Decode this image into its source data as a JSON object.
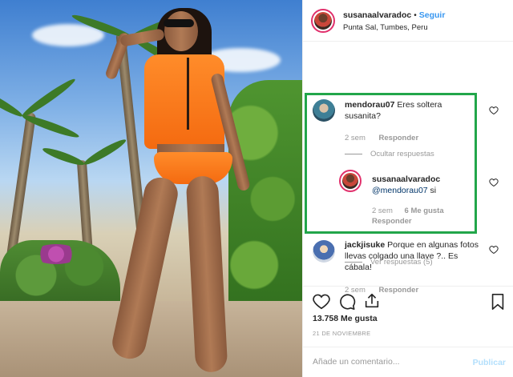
{
  "post": {
    "username": "susanaalvaradoc",
    "separator": "•",
    "follow_label": "Seguir",
    "location": "Punta Sal, Tumbes, Peru"
  },
  "comments": [
    {
      "username": "mendorau07",
      "text": "Eres soltera susanita?⁣",
      "time": "2 sem",
      "reply_label": "Responder",
      "toggle_replies": "Ocultar respuestas",
      "replies": [
        {
          "username": "susanaalvaradoc",
          "mention": "@mendorau07",
          "text": " si",
          "time": "2 sem",
          "likes": "6 Me gusta",
          "reply_label": "Responder"
        }
      ]
    },
    {
      "username": "jackjisuke",
      "text": "Porque en algunas fotos llevas colgado una llave ⁣?.. Es cábala! ⁣",
      "time": "2 sem",
      "reply_label": "Responder",
      "toggle_replies": "Ver respuestas (5)"
    }
  ],
  "actions": {
    "likes": "13.758 Me gusta",
    "date": "21 DE NOVIEMBRE"
  },
  "add_comment": {
    "placeholder": "Añade un comentario...",
    "publish_label": "Publicar"
  },
  "colors": {
    "link_blue": "#3897f0",
    "highlight_green": "#22a64a",
    "meta_gray": "#999999"
  }
}
